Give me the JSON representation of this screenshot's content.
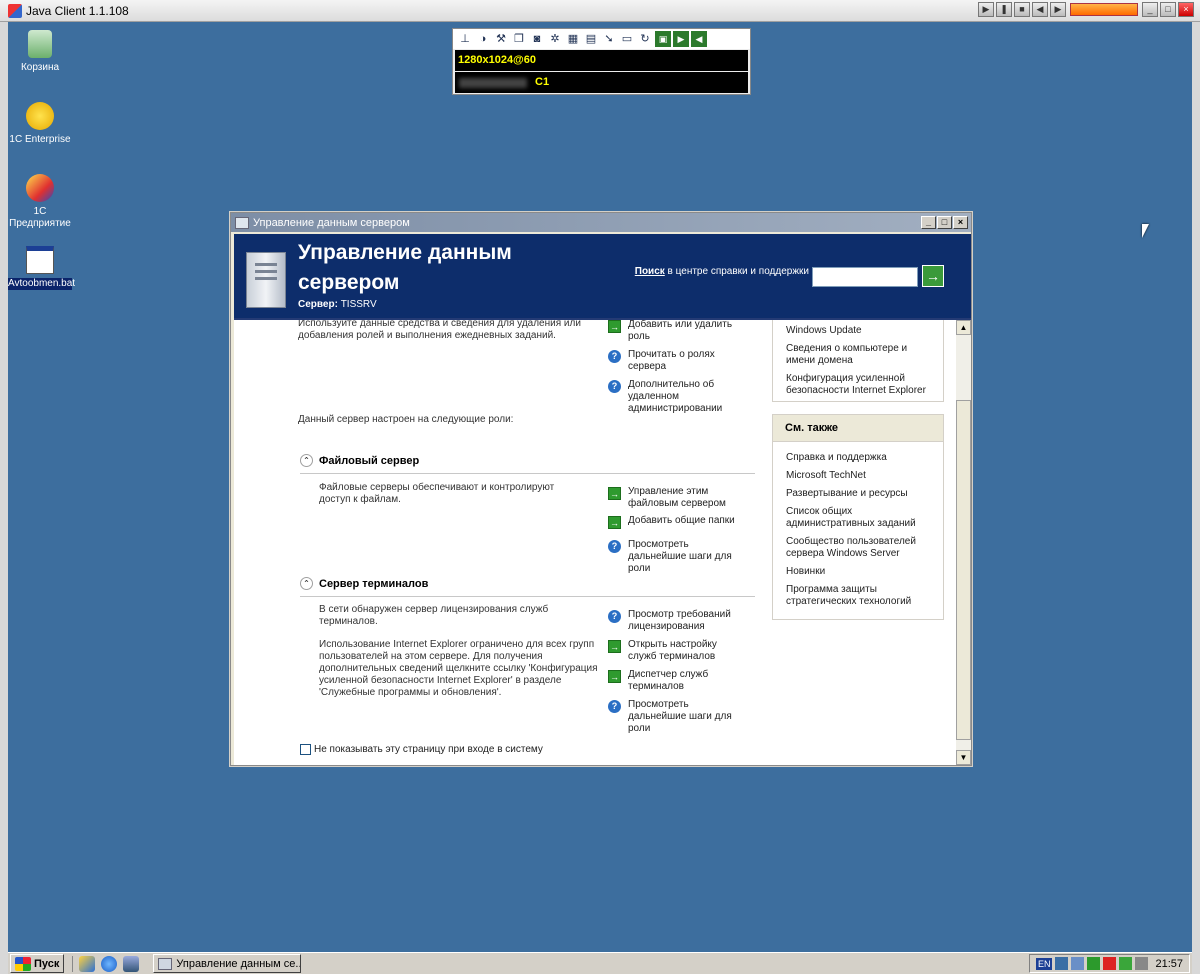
{
  "client": {
    "title": "Java Client 1.1.108"
  },
  "kvm": {
    "resolution": "1280x1024@60",
    "channel": "C1"
  },
  "desktop_icons": [
    {
      "label": "Корзина"
    },
    {
      "label": "1C Enterprise"
    },
    {
      "label": "1C Предприятие"
    },
    {
      "label": "Avtoobmen.bat"
    }
  ],
  "window": {
    "title": "Управление данным сервером",
    "heading": "Управление данным сервером",
    "server_label": "Сервер:",
    "server_name": "TISSRV",
    "search_bold": "Поиск",
    "search_rest": " в центре справки и поддержки",
    "search_go": "→"
  },
  "main": {
    "intro": "Используйте данные средства и сведения для удаления или добавления ролей и выполнения ежедневных заданий.",
    "top_links": [
      "Добавить или удалить роль",
      "Прочитать о ролях сервера",
      "Дополнительно об удаленном администрировании"
    ],
    "roles_intro": "Данный сервер настроен на следующие роли:",
    "file_server": {
      "title": "Файловый сервер",
      "desc": "Файловые серверы обеспечивают и контролируют доступ к файлам.",
      "links": [
        "Управление этим файловым сервером",
        "Добавить общие папки",
        "Просмотреть дальнейшие шаги для роли"
      ]
    },
    "terminal_server": {
      "title": "Сервер терминалов",
      "desc1": "В сети обнаружен сервер лицензирования служб терминалов.",
      "desc2": "Использование Internet Explorer ограничено для всех групп пользователей на этом сервере. Для получения дополнительных сведений щелкните ссылку 'Конфигурация усиленной безопасности Internet Explorer' в разделе 'Служебные программы и обновления'.",
      "links": [
        "Просмотр требований лицензирования",
        "Открыть настройку служб терминалов",
        "Диспетчер служб терминалов",
        "Просмотреть дальнейшие шаги для роли"
      ]
    },
    "checkbox_label": "Не показывать эту страницу при входе в систему"
  },
  "sidebar": {
    "tools_items": [
      "Windows Update",
      "Сведения о компьютере и имени домена",
      "Конфигурация усиленной безопасности Internet Explorer"
    ],
    "see_also_title": "См. также",
    "see_also_items": [
      "Справка и поддержка",
      "Microsoft TechNet",
      "Развертывание и ресурсы",
      "Список общих административных заданий",
      "Сообщество пользователей сервера Windows Server",
      "Новинки",
      "Программа защиты стратегических технологий"
    ]
  },
  "taskbar": {
    "start": "Пуск",
    "task": "Управление данным се...",
    "lang": "EN",
    "clock": "21:57"
  },
  "colors": {
    "banner": "#0d2d6b",
    "desktop": "#3d6e9e",
    "link_arrow": "#2f9a2f",
    "help_icon": "#2b6fc4"
  }
}
